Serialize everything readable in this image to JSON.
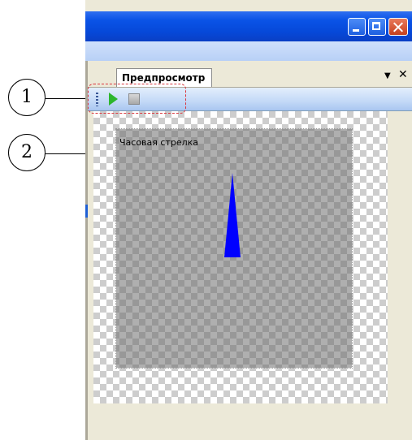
{
  "window": {
    "panel_tab_label": "Предпросмотр",
    "tab_menu_glyph": "▼",
    "tab_close_glyph": "✕"
  },
  "toolbar": {
    "play_icon": "play-icon",
    "stop_icon": "stop-icon"
  },
  "preview": {
    "object_label": "Часовая стрелка",
    "hand_color": "#0000ff"
  },
  "callouts": [
    {
      "number": "1"
    },
    {
      "number": "2"
    }
  ],
  "colors": {
    "titlebar": "#0a53e6",
    "highlight_dash": "#d9363e",
    "play_green": "#2db62d"
  }
}
